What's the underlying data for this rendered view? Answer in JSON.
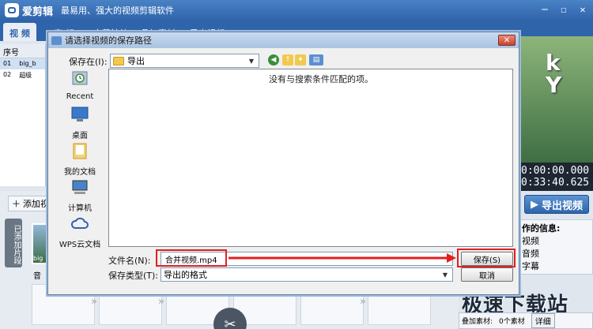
{
  "app": {
    "name": "爱剪辑",
    "slogan": "最易用、强大的视频剪辑软件",
    "tabs": [
      "视 频",
      "音 频",
      "字幕特效",
      "叠加素材",
      "导出视频"
    ]
  },
  "left_panel": {
    "header": "序号",
    "rows": [
      {
        "num": "01",
        "name": "big_b"
      },
      {
        "num": "02",
        "name": "超级"
      }
    ]
  },
  "preview": {
    "text_lines": [
      "k",
      "Y"
    ],
    "time_current": "0:00:00.000",
    "time_total": "0:33:40.625",
    "export_label": "导出视频"
  },
  "info_panel": {
    "title": "作的信息:",
    "items": [
      "视频",
      "音频",
      "字幕"
    ]
  },
  "bottom": {
    "add_label": "添加视",
    "added_tab": "已添加片段",
    "thumb_caption": "big",
    "audio_label": "音",
    "watermark": "极速下载站",
    "status_label": "叠加素材:",
    "status_value": "0个素材",
    "detail_label": "详细"
  },
  "dialog": {
    "title": "请选择视频的保存路径",
    "save_in_label": "保存在(I):",
    "save_in_value": "导出",
    "places": [
      "Recent",
      "桌面",
      "我的文档",
      "计算机",
      "WPS云文档"
    ],
    "empty_message": "没有与搜索条件匹配的项。",
    "filename_label": "文件名(N):",
    "filename_value": "合并视频.mp4",
    "filetype_label": "保存类型(T):",
    "filetype_value": "导出的格式",
    "save_button": "保存(S)",
    "cancel_button": "取消",
    "colors": {
      "highlight": "#e02020",
      "accent": "#2f64ab"
    }
  }
}
